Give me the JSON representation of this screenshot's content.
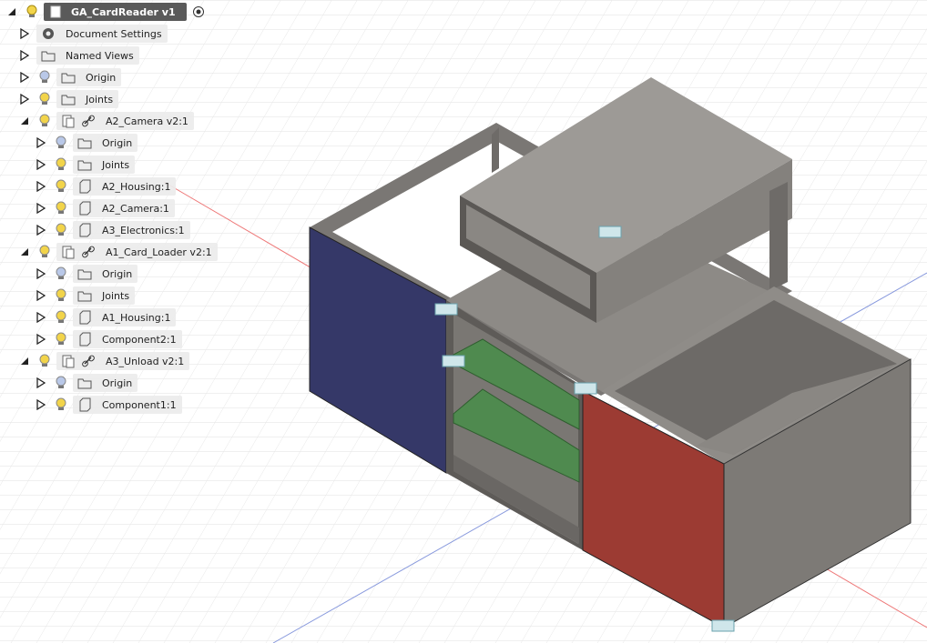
{
  "browser": {
    "root": {
      "label": "GA_CardReader v1"
    },
    "items": [
      {
        "label": "Document Settings",
        "icon": "gear-icon"
      },
      {
        "label": "Named Views",
        "icon": "folder-icon"
      },
      {
        "label": "Origin",
        "icon": "folder-icon",
        "bulb": "off"
      },
      {
        "label": "Joints",
        "icon": "folder-icon",
        "bulb": "on"
      },
      {
        "label": "A2_Camera v2:1",
        "icon": "component-icon",
        "bulb": "on",
        "linked": true
      },
      {
        "label": "Origin",
        "icon": "folder-icon",
        "bulb": "off"
      },
      {
        "label": "Joints",
        "icon": "folder-icon",
        "bulb": "on"
      },
      {
        "label": "A2_Housing:1",
        "icon": "body-icon",
        "bulb": "on"
      },
      {
        "label": "A2_Camera:1",
        "icon": "body-icon",
        "bulb": "on"
      },
      {
        "label": "A3_Electronics:1",
        "icon": "body-icon",
        "bulb": "on"
      },
      {
        "label": "A1_Card_Loader v2:1",
        "icon": "component-icon",
        "bulb": "on",
        "linked": true
      },
      {
        "label": "Origin",
        "icon": "folder-icon",
        "bulb": "off"
      },
      {
        "label": "Joints",
        "icon": "folder-icon",
        "bulb": "on"
      },
      {
        "label": "A1_Housing:1",
        "icon": "body-icon",
        "bulb": "on"
      },
      {
        "label": "Component2:1",
        "icon": "body-icon",
        "bulb": "on"
      },
      {
        "label": "A3_Unload v2:1",
        "icon": "component-icon",
        "bulb": "on",
        "linked": true
      },
      {
        "label": "Origin",
        "icon": "folder-icon",
        "bulb": "off"
      },
      {
        "label": "Component1:1",
        "icon": "body-icon",
        "bulb": "on"
      }
    ]
  },
  "colors": {
    "bulb_on": "#f2d44a",
    "bulb_off": "#b9c8e8",
    "face_blue": "#353868",
    "face_red": "#9c3b33",
    "pcb_green": "#4f8a4f",
    "body_gray": "#8a8782"
  }
}
